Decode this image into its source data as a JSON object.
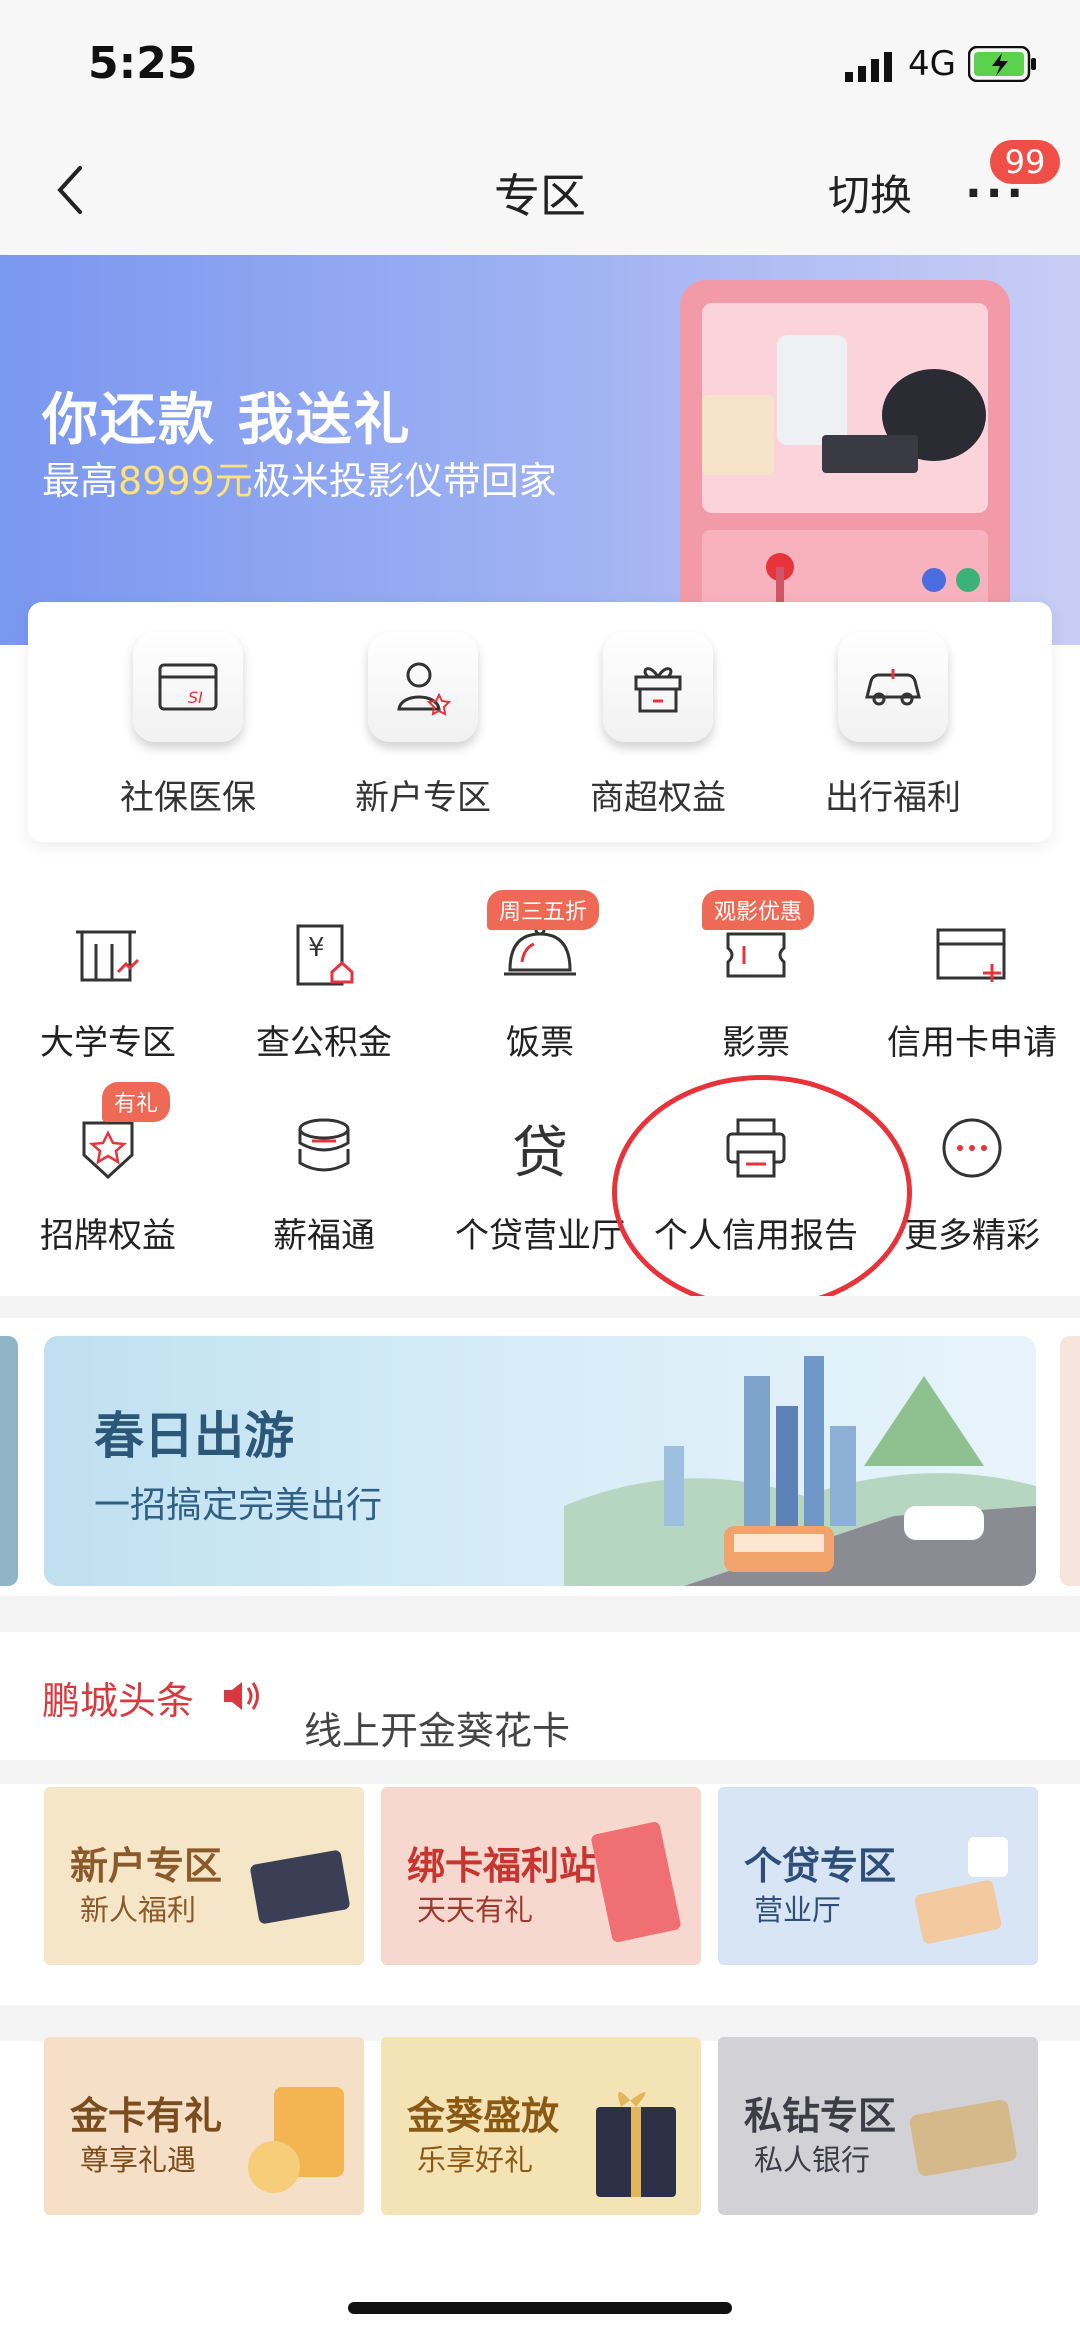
{
  "status_bar": {
    "time": "5:25",
    "network": "4G"
  },
  "nav": {
    "title": "专区",
    "switch_label": "切换",
    "more_label": "···",
    "badge": "99"
  },
  "hero": {
    "title": "你还款 我送礼",
    "sub_prefix": "最高",
    "sub_highlight": "8999元",
    "sub_suffix": "极米投影仪带回家"
  },
  "quick_card": [
    {
      "label": "社保医保",
      "icon": "social-insurance-card-icon"
    },
    {
      "label": "新户专区",
      "icon": "new-user-icon"
    },
    {
      "label": "商超权益",
      "icon": "gift-icon"
    },
    {
      "label": "出行福利",
      "icon": "car-icon"
    }
  ],
  "grid_row1": [
    {
      "label": "大学专区",
      "icon": "university-icon"
    },
    {
      "label": "查公积金",
      "icon": "housing-fund-icon"
    },
    {
      "label": "饭票",
      "icon": "meal-cloche-icon",
      "tag": "周三五折"
    },
    {
      "label": "影票",
      "icon": "movie-ticket-icon",
      "tag": "观影优惠"
    },
    {
      "label": "信用卡申请",
      "icon": "credit-card-add-icon"
    }
  ],
  "grid_row2": [
    {
      "label": "招牌权益",
      "icon": "badge-star-icon",
      "tag": "有礼"
    },
    {
      "label": "薪福通",
      "icon": "coin-stack-icon"
    },
    {
      "label": "个贷营业厅",
      "icon": "loan-char-icon",
      "glyph": "贷"
    },
    {
      "label": "个人信用报告",
      "icon": "printer-icon"
    },
    {
      "label": "更多精彩",
      "icon": "more-circle-icon"
    }
  ],
  "spring_banner": {
    "title": "春日出游",
    "subtitle": "一招搞定完美出行"
  },
  "news": {
    "title": "鹏城头条",
    "text": "线上开金葵花卡"
  },
  "tiles_row1": [
    {
      "title": "新户专区",
      "subtitle": "新人福利"
    },
    {
      "title": "绑卡福利站",
      "subtitle": "天天有礼"
    },
    {
      "title": "个贷专区",
      "subtitle": "营业厅"
    }
  ],
  "tiles_row2": [
    {
      "title": "金卡有礼",
      "subtitle": "尊享礼遇"
    },
    {
      "title": "金葵盛放",
      "subtitle": "乐享好礼"
    },
    {
      "title": "私钻专区",
      "subtitle": "私人银行"
    }
  ],
  "colors": {
    "accent_red": "#e8333a",
    "tag_orange": "#ef6a56",
    "hero_blue": "#7a97f0"
  }
}
